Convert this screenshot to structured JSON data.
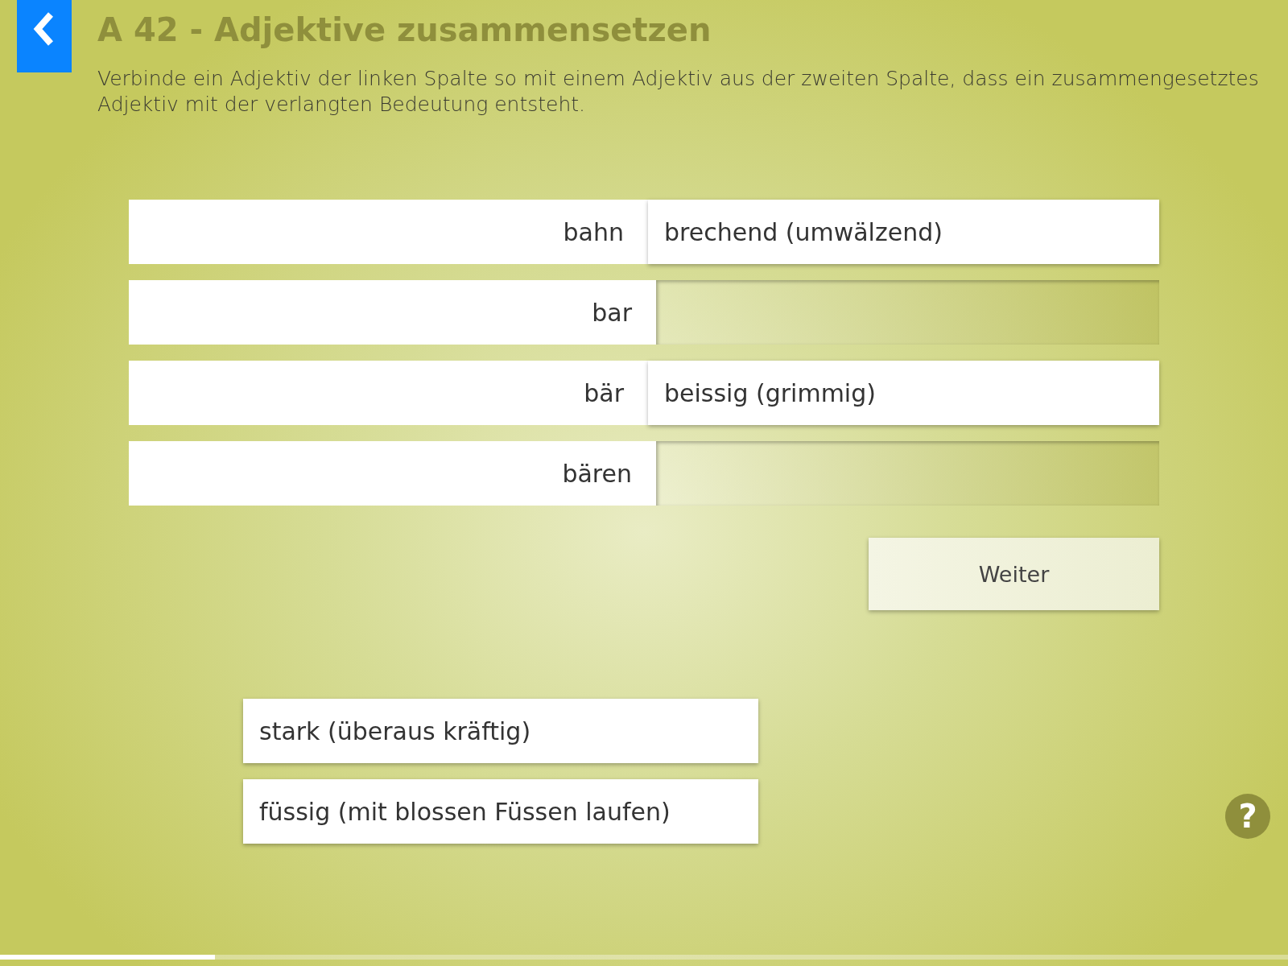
{
  "title": "A 42 - Adjektive zusammensetzen",
  "instruction": "Verbinde ein Adjektiv der linken Spalte so mit einem Adjektiv aus der zweiten Spalte, dass ein zusammengesetztes Adjektiv mit der verlangten Bedeutung entsteht.",
  "rows": [
    {
      "stem": "bahn",
      "answer": "brechend (umwälzend)"
    },
    {
      "stem": "bar"
    },
    {
      "stem": "bär",
      "answer": "beissig (grimmig)"
    },
    {
      "stem": "bären"
    }
  ],
  "next_button": "Weiter",
  "options": [
    "stark (überaus kräftig)",
    "füssig (mit blossen Füssen laufen)"
  ],
  "help_button": "?",
  "progress": {
    "level": 0.167
  }
}
